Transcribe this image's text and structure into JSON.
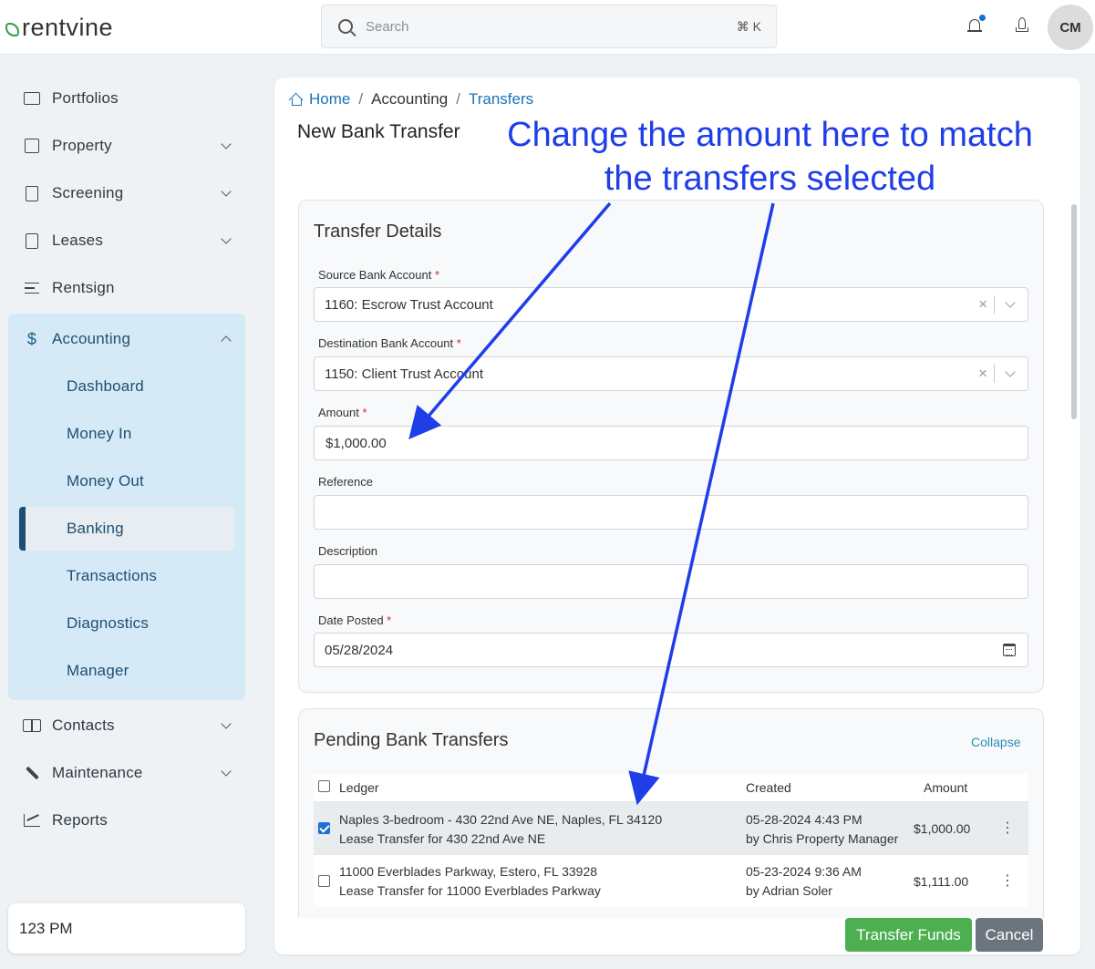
{
  "app": {
    "brand": "rentvine"
  },
  "topbar": {
    "search_placeholder": "Search",
    "shortcut": "⌘ K",
    "avatar_initials": "CM"
  },
  "sidebar": {
    "items": [
      {
        "label": "Portfolios"
      },
      {
        "label": "Property"
      },
      {
        "label": "Screening"
      },
      {
        "label": "Leases"
      },
      {
        "label": "Rentsign"
      },
      {
        "label": "Accounting"
      },
      {
        "label": "Contacts"
      },
      {
        "label": "Maintenance"
      },
      {
        "label": "Reports"
      }
    ],
    "accounting_sub": [
      {
        "label": "Dashboard"
      },
      {
        "label": "Money In"
      },
      {
        "label": "Money Out"
      },
      {
        "label": "Banking"
      },
      {
        "label": "Transactions"
      },
      {
        "label": "Diagnostics"
      },
      {
        "label": "Manager"
      }
    ],
    "company": "123 PM"
  },
  "breadcrumb": {
    "home": "Home",
    "section": "Accounting",
    "current": "Transfers",
    "sep": "/"
  },
  "page": {
    "title": "New Bank Transfer"
  },
  "transfer": {
    "title": "Transfer Details",
    "source_label": "Source Bank Account",
    "source_value": "1160: Escrow Trust Account",
    "dest_label": "Destination Bank Account",
    "dest_value": "1150: Client Trust Account",
    "amount_label": "Amount",
    "amount_value": "$1,000.00",
    "reference_label": "Reference",
    "description_label": "Description",
    "date_label": "Date Posted",
    "date_value": "05/28/2024",
    "required": "*",
    "clear": "×"
  },
  "pending": {
    "title": "Pending Bank Transfers",
    "collapse": "Collapse",
    "headers": {
      "ledger": "Ledger",
      "created": "Created",
      "amount": "Amount"
    },
    "rows": [
      {
        "line1": "Naples 3-bedroom - 430 22nd Ave NE, Naples, FL 34120",
        "line2": "Lease Transfer for 430 22nd Ave NE",
        "date": "05-28-2024 4:43 PM",
        "by": "by Chris Property Manager",
        "amount": "$1,000.00",
        "checked": true
      },
      {
        "line1": "11000 Everblades Parkway, Estero, FL 33928",
        "line2": "Lease Transfer for 11000 Everblades Parkway",
        "date": "05-23-2024 9:36 AM",
        "by": "by Adrian Soler",
        "amount": "$1,111.00",
        "checked": false
      }
    ],
    "kebab": "⋮"
  },
  "actions": {
    "transfer": "Transfer Funds",
    "cancel": "Cancel"
  },
  "annotation": {
    "line1": "Change the amount here to match",
    "line2": "the transfers selected",
    "color": "#1f3ee8"
  },
  "colors": {
    "accent": "#1a73b8",
    "success": "#4caf50",
    "nav_active_bg": "#d5eaf6"
  }
}
